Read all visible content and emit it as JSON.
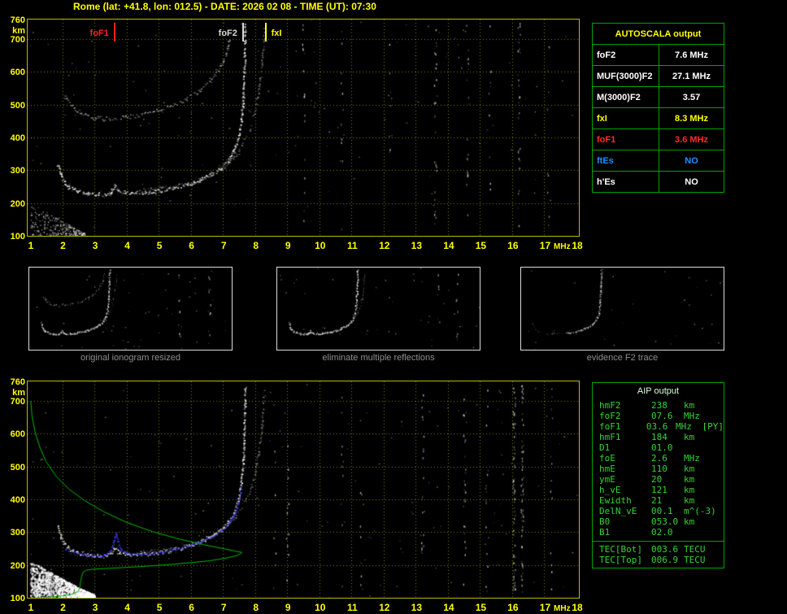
{
  "title": "Rome (lat: +41.8, lon: 012.5) - DATE: 2026 02 08 - TIME (UT): 07:30",
  "colors": {
    "axis_yellow": "#ffff00",
    "grid_yellow": "#cdcd00",
    "table_border_green": "#00a400",
    "value_red": "#ff2a2a",
    "value_blue": "#1e90ff",
    "aip_text_green": "#35d435",
    "profile_green": "#00bb00",
    "scaled_trace_blue": "#3c3cff",
    "echo_white": "#ffffff"
  },
  "autoscala": {
    "header": "AUTOSCALA output",
    "rows": [
      {
        "label": "foF2",
        "value": "7.6 MHz",
        "color": "white"
      },
      {
        "label": "MUF(3000)F2",
        "value": "27.1 MHz",
        "color": "white"
      },
      {
        "label": "M(3000)F2",
        "value": "3.57",
        "color": "white"
      },
      {
        "label": "fxI",
        "value": "8.3 MHz",
        "color": "yellow"
      },
      {
        "label": "foF1",
        "value": "3.6 MHz",
        "color": "red"
      },
      {
        "label": "ftEs",
        "value": "NO",
        "color": "blue"
      },
      {
        "label": "h'Es",
        "value": "NO",
        "color": "white"
      }
    ]
  },
  "thumbnails": [
    {
      "caption": "original ionogram resized",
      "mode": "full"
    },
    {
      "caption": "eliminate multiple reflections",
      "mode": "clean"
    },
    {
      "caption": "evidence F2 trace",
      "mode": "f2"
    }
  ],
  "aip": {
    "header": "AIP output",
    "rows": [
      {
        "name": "hmF2",
        "value": "238",
        "unit": "km",
        "note": ""
      },
      {
        "name": "foF2",
        "value": "07.6",
        "unit": "MHz",
        "note": ""
      },
      {
        "name": "foF1",
        "value": "03.6",
        "unit": "MHz",
        "note": "[PY]"
      },
      {
        "name": "hmF1",
        "value": "184",
        "unit": "km",
        "note": ""
      },
      {
        "name": "D1",
        "value": "01.0",
        "unit": "",
        "note": ""
      },
      {
        "name": "foE",
        "value": "2.6",
        "unit": "MHz",
        "note": ""
      },
      {
        "name": "hmE",
        "value": "110",
        "unit": "km",
        "note": ""
      },
      {
        "name": "ymE",
        "value": "20",
        "unit": "km",
        "note": ""
      },
      {
        "name": "h_vE",
        "value": "121",
        "unit": "km",
        "note": ""
      },
      {
        "name": "Ewidth",
        "value": "21",
        "unit": "km",
        "note": ""
      },
      {
        "name": "DelN_vE",
        "value": "00.1",
        "unit": "m^(-3)",
        "note": ""
      },
      {
        "name": "B0",
        "value": "053.0",
        "unit": "km",
        "note": ""
      },
      {
        "name": "B1",
        "value": "02.0",
        "unit": "",
        "note": ""
      }
    ],
    "tec_rows": [
      {
        "name": "TEC[Bot]",
        "value": "003.6",
        "unit": "TECU"
      },
      {
        "name": "TEC[Top]",
        "value": "006.9",
        "unit": "TECU"
      }
    ]
  },
  "chart_data": [
    {
      "type": "scatter",
      "name": "recorded ionogram with AUTOSCALA markers",
      "xlabel": "MHz",
      "ylabel": "km",
      "xlim": [
        1,
        18
      ],
      "ylim": [
        100,
        760
      ],
      "x_ticks": [
        1,
        2,
        3,
        4,
        5,
        6,
        7,
        8,
        9,
        10,
        11,
        12,
        13,
        14,
        15,
        16,
        17,
        18
      ],
      "y_ticks": [
        760,
        700,
        600,
        500,
        400,
        300,
        200,
        100
      ],
      "grid": "dotted",
      "markers": [
        {
          "label": "foF1",
          "freq_mhz": 3.6,
          "color": "#ff2222",
          "side": "left"
        },
        {
          "label": "foF2",
          "freq_mhz": 7.6,
          "color": "#d8d8d8",
          "side": "left"
        },
        {
          "label": "fxI",
          "freq_mhz": 8.3,
          "color": "#ffff00",
          "side": "right"
        }
      ],
      "traces": [
        {
          "name": "F-region o-mode echo",
          "style": {
            "alpha": 0.95,
            "spread": 2.4,
            "halo": true
          },
          "points": [
            [
              1.85,
              320
            ],
            [
              1.95,
              286
            ],
            [
              2.05,
              264
            ],
            [
              2.2,
              250
            ],
            [
              2.45,
              239
            ],
            [
              2.8,
              231
            ],
            [
              3.1,
              228
            ],
            [
              3.35,
              228
            ],
            [
              3.5,
              234
            ],
            [
              3.62,
              253
            ],
            [
              3.72,
              241
            ],
            [
              3.95,
              234
            ],
            [
              4.3,
              232
            ],
            [
              4.7,
              234
            ],
            [
              5.1,
              240
            ],
            [
              5.5,
              248
            ],
            [
              5.9,
              258
            ],
            [
              6.25,
              271
            ],
            [
              6.6,
              287
            ],
            [
              6.9,
              306
            ],
            [
              7.15,
              330
            ],
            [
              7.33,
              360
            ],
            [
              7.47,
              400
            ],
            [
              7.56,
              450
            ],
            [
              7.61,
              510
            ],
            [
              7.64,
              570
            ],
            [
              7.66,
              635
            ],
            [
              7.68,
              745
            ]
          ]
        },
        {
          "name": "F-region x-mode echo",
          "style": {
            "alpha": 0.45,
            "spread": 2,
            "dens": 0.7
          },
          "points": [
            [
              4.4,
              240
            ],
            [
              4.9,
              244
            ],
            [
              5.4,
              251
            ],
            [
              5.85,
              260
            ],
            [
              6.3,
              273
            ],
            [
              6.7,
              291
            ],
            [
              7.05,
              312
            ],
            [
              7.35,
              342
            ],
            [
              7.6,
              380
            ],
            [
              7.82,
              425
            ],
            [
              7.98,
              480
            ],
            [
              8.1,
              545
            ],
            [
              8.2,
              620
            ],
            [
              8.28,
              730
            ]
          ]
        },
        {
          "name": "second-hop multiple echo",
          "style": {
            "alpha": 0.55,
            "spread": 2.6,
            "dens": 0.75
          },
          "points": [
            [
              2.05,
              530
            ],
            [
              2.3,
              495
            ],
            [
              2.6,
              472
            ],
            [
              3.0,
              460
            ],
            [
              3.4,
              458
            ],
            [
              3.9,
              462
            ],
            [
              4.4,
              470
            ],
            [
              4.9,
              482
            ],
            [
              5.4,
              498
            ],
            [
              5.85,
              518
            ],
            [
              6.25,
              544
            ],
            [
              6.6,
              576
            ],
            [
              6.9,
              615
            ],
            [
              7.1,
              660
            ],
            [
              7.22,
              710
            ]
          ]
        }
      ],
      "noise_columns": [
        {
          "f": 9.5,
          "n": 16
        },
        {
          "f": 10.7,
          "n": 10
        },
        {
          "f": 12.2,
          "n": 8
        },
        {
          "f": 13.6,
          "n": 22
        },
        {
          "f": 14.6,
          "n": 18
        },
        {
          "f": 15.3,
          "n": 10
        },
        {
          "f": 16.2,
          "n": 26
        },
        {
          "f": 17.1,
          "n": 9
        }
      ],
      "noise_wedge": {
        "fmin": 1.0,
        "fmax": 2.7,
        "hmax": 195,
        "n": 260,
        "bright": false
      },
      "speckles": 150
    },
    {
      "type": "scatter",
      "name": "restored ionogram with electron density profile",
      "xlabel": "MHz",
      "ylabel": "km",
      "xlim": [
        1,
        18
      ],
      "ylim": [
        100,
        760
      ],
      "x_ticks": [
        1,
        2,
        3,
        4,
        5,
        6,
        7,
        8,
        9,
        10,
        11,
        12,
        13,
        14,
        15,
        16,
        17,
        18
      ],
      "y_ticks": [
        760,
        700,
        600,
        500,
        400,
        300,
        200,
        100
      ],
      "grid": "dotted",
      "traces": [
        {
          "name": "F-region o-mode echo",
          "style": {
            "alpha": 0.95,
            "spread": 2.4,
            "halo": true
          },
          "points": [
            [
              1.85,
              320
            ],
            [
              1.95,
              286
            ],
            [
              2.05,
              264
            ],
            [
              2.2,
              250
            ],
            [
              2.45,
              239
            ],
            [
              2.8,
              231
            ],
            [
              3.1,
              228
            ],
            [
              3.35,
              228
            ],
            [
              3.5,
              234
            ],
            [
              3.62,
              253
            ],
            [
              3.72,
              241
            ],
            [
              3.95,
              234
            ],
            [
              4.3,
              232
            ],
            [
              4.7,
              234
            ],
            [
              5.1,
              240
            ],
            [
              5.5,
              248
            ],
            [
              5.9,
              258
            ],
            [
              6.25,
              271
            ],
            [
              6.6,
              287
            ],
            [
              6.9,
              306
            ],
            [
              7.15,
              330
            ],
            [
              7.33,
              360
            ],
            [
              7.47,
              400
            ],
            [
              7.56,
              450
            ],
            [
              7.61,
              510
            ],
            [
              7.64,
              570
            ],
            [
              7.66,
              635
            ],
            [
              7.68,
              745
            ]
          ]
        },
        {
          "name": "F-region x-mode echo",
          "style": {
            "alpha": 0.4,
            "spread": 2,
            "dens": 0.65
          },
          "points": [
            [
              4.4,
              240
            ],
            [
              4.9,
              244
            ],
            [
              5.4,
              251
            ],
            [
              5.85,
              260
            ],
            [
              6.3,
              273
            ],
            [
              6.7,
              291
            ],
            [
              7.05,
              312
            ],
            [
              7.35,
              342
            ],
            [
              7.6,
              380
            ],
            [
              7.82,
              425
            ],
            [
              7.98,
              480
            ],
            [
              8.1,
              545
            ],
            [
              8.2,
              620
            ],
            [
              8.28,
              730
            ]
          ]
        }
      ],
      "profile": {
        "name": "electron density profile",
        "color": "#00bb00",
        "points": [
          [
            1.02,
            700
          ],
          [
            1.06,
            655
          ],
          [
            1.15,
            608
          ],
          [
            1.3,
            560
          ],
          [
            1.5,
            515
          ],
          [
            1.8,
            472
          ],
          [
            2.2,
            432
          ],
          [
            2.7,
            396
          ],
          [
            3.3,
            362
          ],
          [
            4.0,
            330
          ],
          [
            4.8,
            302
          ],
          [
            5.6,
            280
          ],
          [
            6.4,
            262
          ],
          [
            7.1,
            248
          ],
          [
            7.5,
            240
          ],
          [
            7.6,
            238
          ],
          [
            7.45,
            229
          ],
          [
            7.1,
            221
          ],
          [
            6.6,
            213
          ],
          [
            6.0,
            207
          ],
          [
            5.3,
            201
          ],
          [
            4.6,
            196
          ],
          [
            3.9,
            192
          ],
          [
            3.3,
            189
          ],
          [
            2.95,
            187
          ],
          [
            2.75,
            184
          ],
          [
            2.65,
            178
          ],
          [
            2.6,
            163
          ],
          [
            2.57,
            148
          ],
          [
            2.55,
            133
          ],
          [
            2.5,
            120
          ],
          [
            2.35,
            112
          ],
          [
            2.1,
            107
          ],
          [
            1.75,
            103
          ],
          [
            1.35,
            100
          ],
          [
            1.05,
            99
          ]
        ]
      },
      "scaled_trace": {
        "name": "autoscaled trace",
        "color": "#3c3cff",
        "points": [
          [
            2.1,
            249
          ],
          [
            2.35,
            241
          ],
          [
            2.6,
            235
          ],
          [
            2.9,
            231
          ],
          [
            3.15,
            230
          ],
          [
            3.35,
            233
          ],
          [
            3.5,
            246
          ],
          [
            3.6,
            275
          ],
          [
            3.66,
            298
          ],
          [
            3.72,
            272
          ],
          [
            3.82,
            248
          ],
          [
            4.0,
            239
          ],
          [
            4.3,
            235
          ],
          [
            4.7,
            236
          ],
          [
            5.1,
            242
          ],
          [
            5.5,
            250
          ],
          [
            5.9,
            260
          ],
          [
            6.3,
            273
          ],
          [
            6.65,
            289
          ],
          [
            6.95,
            308
          ],
          [
            7.2,
            332
          ],
          [
            7.38,
            362
          ],
          [
            7.5,
            400
          ],
          [
            7.57,
            440
          ]
        ]
      },
      "noise_columns": [
        {
          "f": 8.6,
          "n": 8
        },
        {
          "f": 9.0,
          "n": 12
        },
        {
          "f": 10.7,
          "n": 10
        },
        {
          "f": 11.3,
          "n": 8
        },
        {
          "f": 13.2,
          "n": 20
        },
        {
          "f": 14.5,
          "n": 24
        },
        {
          "f": 15.2,
          "n": 14
        },
        {
          "f": 16.05,
          "n": 70
        },
        {
          "f": 16.3,
          "n": 60
        },
        {
          "f": 17.2,
          "n": 12
        }
      ],
      "noise_wedge": {
        "fmin": 1.0,
        "fmax": 3.0,
        "hmax": 205,
        "n": 1200,
        "bright": true
      },
      "speckles": 170
    }
  ]
}
